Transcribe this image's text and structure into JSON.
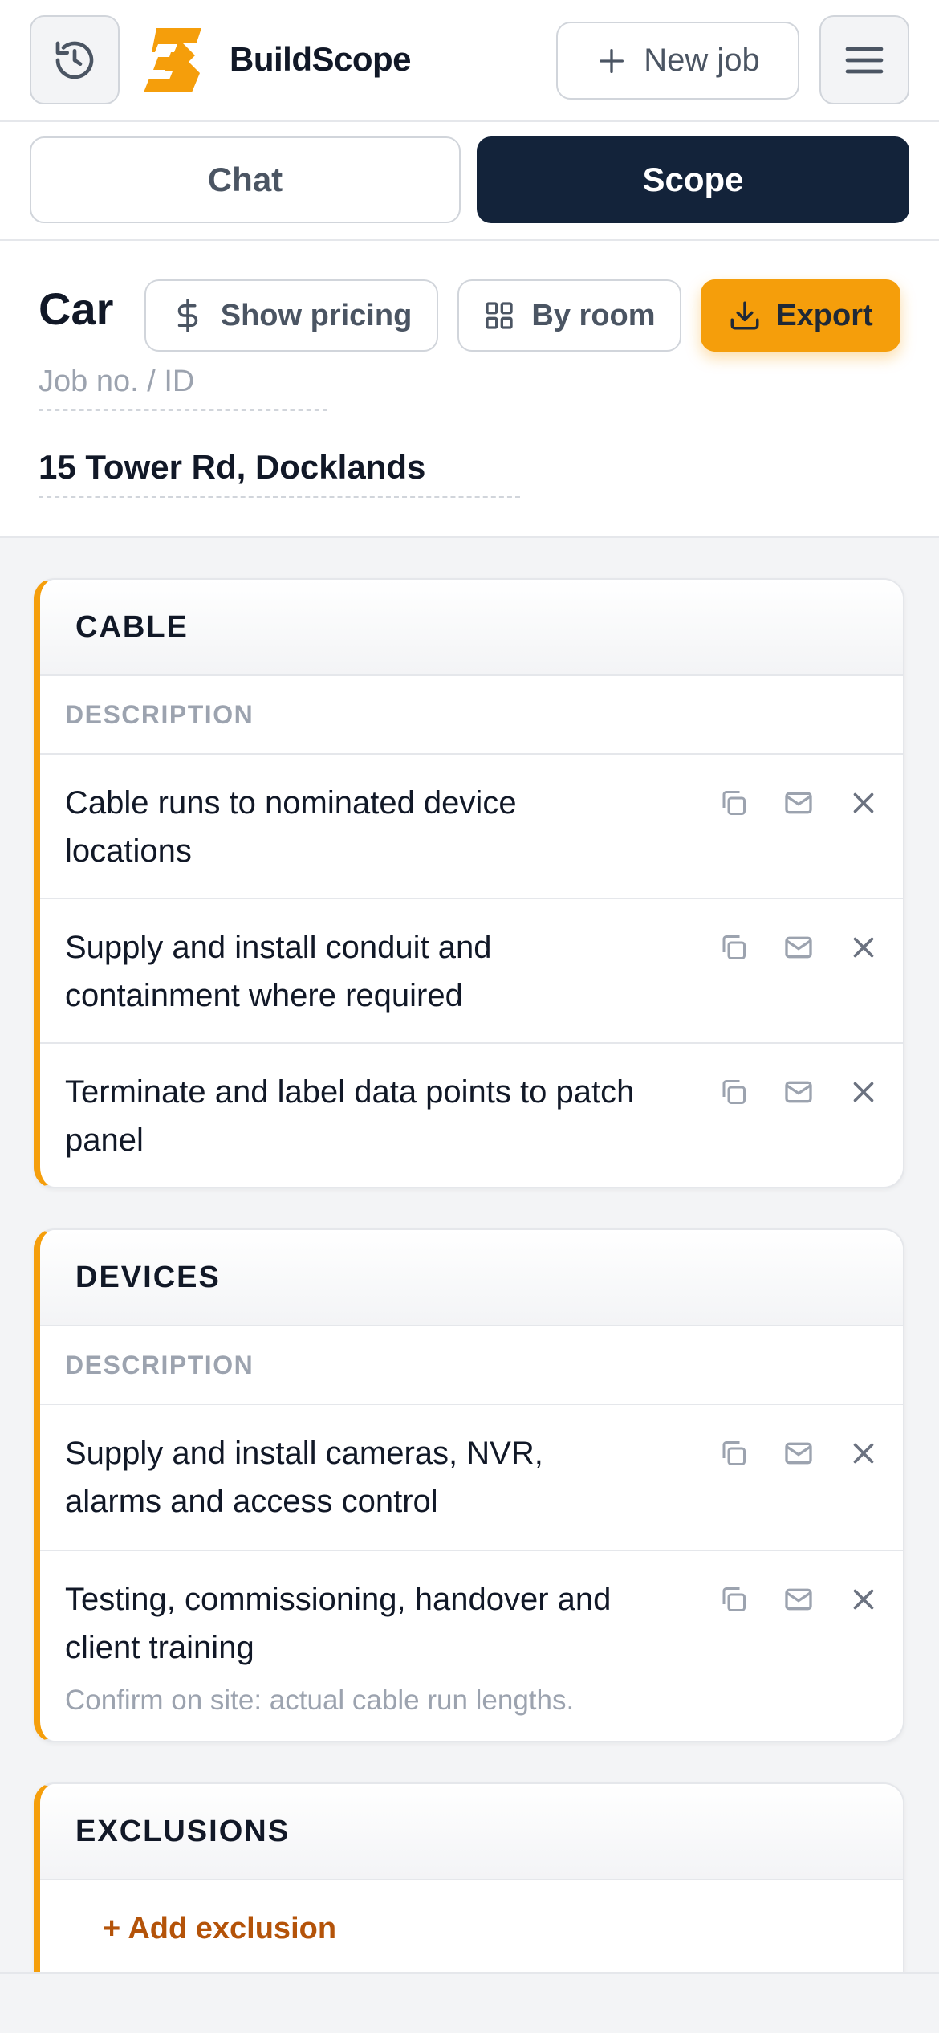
{
  "header": {
    "brand": "BuildScope",
    "new_job_label": "New job",
    "history_icon": "history-icon",
    "menu_icon": "hamburger-menu-icon",
    "accent": "#f59e0b"
  },
  "tabs": [
    {
      "label": "Chat",
      "active": false
    },
    {
      "label": "Scope",
      "active": true
    }
  ],
  "job": {
    "title": "Car",
    "job_id_placeholder": "Job no. / ID",
    "address": "15 Tower Rd, Docklands",
    "show_pricing_label": "Show pricing",
    "by_room_label": "By room",
    "export_label": "Export"
  },
  "sections": [
    {
      "title": "CABLE",
      "column_header": "DESCRIPTION",
      "items": [
        {
          "text": "Cable runs to nominated device locations"
        },
        {
          "text": "Supply and install conduit and containment where required"
        },
        {
          "text": "Terminate and label data points to patch panel"
        }
      ]
    },
    {
      "title": "DEVICES",
      "column_header": "DESCRIPTION",
      "items": [
        {
          "text": "Supply and install cameras, NVR, alarms and access control"
        },
        {
          "text": "Testing, commissioning, handover and client training",
          "note": "Confirm on site: actual cable run lengths."
        }
      ]
    },
    {
      "title": "EXCLUSIONS",
      "add_label": "+ Add exclusion"
    }
  ]
}
